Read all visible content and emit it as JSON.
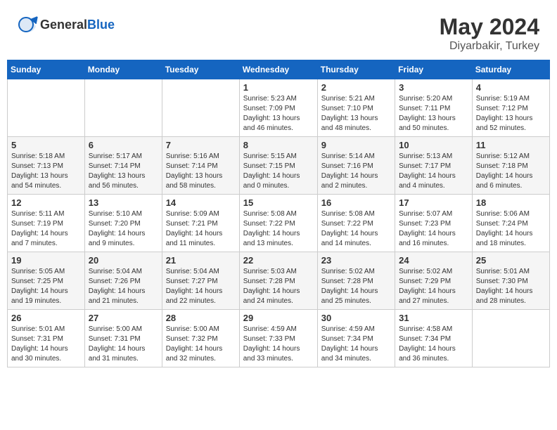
{
  "header": {
    "logo_general": "General",
    "logo_blue": "Blue",
    "month_year": "May 2024",
    "location": "Diyarbakir, Turkey"
  },
  "days_of_week": [
    "Sunday",
    "Monday",
    "Tuesday",
    "Wednesday",
    "Thursday",
    "Friday",
    "Saturday"
  ],
  "weeks": [
    [
      {
        "day": "",
        "info": ""
      },
      {
        "day": "",
        "info": ""
      },
      {
        "day": "",
        "info": ""
      },
      {
        "day": "1",
        "info": "Sunrise: 5:23 AM\nSunset: 7:09 PM\nDaylight: 13 hours\nand 46 minutes."
      },
      {
        "day": "2",
        "info": "Sunrise: 5:21 AM\nSunset: 7:10 PM\nDaylight: 13 hours\nand 48 minutes."
      },
      {
        "day": "3",
        "info": "Sunrise: 5:20 AM\nSunset: 7:11 PM\nDaylight: 13 hours\nand 50 minutes."
      },
      {
        "day": "4",
        "info": "Sunrise: 5:19 AM\nSunset: 7:12 PM\nDaylight: 13 hours\nand 52 minutes."
      }
    ],
    [
      {
        "day": "5",
        "info": "Sunrise: 5:18 AM\nSunset: 7:13 PM\nDaylight: 13 hours\nand 54 minutes."
      },
      {
        "day": "6",
        "info": "Sunrise: 5:17 AM\nSunset: 7:14 PM\nDaylight: 13 hours\nand 56 minutes."
      },
      {
        "day": "7",
        "info": "Sunrise: 5:16 AM\nSunset: 7:14 PM\nDaylight: 13 hours\nand 58 minutes."
      },
      {
        "day": "8",
        "info": "Sunrise: 5:15 AM\nSunset: 7:15 PM\nDaylight: 14 hours\nand 0 minutes."
      },
      {
        "day": "9",
        "info": "Sunrise: 5:14 AM\nSunset: 7:16 PM\nDaylight: 14 hours\nand 2 minutes."
      },
      {
        "day": "10",
        "info": "Sunrise: 5:13 AM\nSunset: 7:17 PM\nDaylight: 14 hours\nand 4 minutes."
      },
      {
        "day": "11",
        "info": "Sunrise: 5:12 AM\nSunset: 7:18 PM\nDaylight: 14 hours\nand 6 minutes."
      }
    ],
    [
      {
        "day": "12",
        "info": "Sunrise: 5:11 AM\nSunset: 7:19 PM\nDaylight: 14 hours\nand 7 minutes."
      },
      {
        "day": "13",
        "info": "Sunrise: 5:10 AM\nSunset: 7:20 PM\nDaylight: 14 hours\nand 9 minutes."
      },
      {
        "day": "14",
        "info": "Sunrise: 5:09 AM\nSunset: 7:21 PM\nDaylight: 14 hours\nand 11 minutes."
      },
      {
        "day": "15",
        "info": "Sunrise: 5:08 AM\nSunset: 7:22 PM\nDaylight: 14 hours\nand 13 minutes."
      },
      {
        "day": "16",
        "info": "Sunrise: 5:08 AM\nSunset: 7:22 PM\nDaylight: 14 hours\nand 14 minutes."
      },
      {
        "day": "17",
        "info": "Sunrise: 5:07 AM\nSunset: 7:23 PM\nDaylight: 14 hours\nand 16 minutes."
      },
      {
        "day": "18",
        "info": "Sunrise: 5:06 AM\nSunset: 7:24 PM\nDaylight: 14 hours\nand 18 minutes."
      }
    ],
    [
      {
        "day": "19",
        "info": "Sunrise: 5:05 AM\nSunset: 7:25 PM\nDaylight: 14 hours\nand 19 minutes."
      },
      {
        "day": "20",
        "info": "Sunrise: 5:04 AM\nSunset: 7:26 PM\nDaylight: 14 hours\nand 21 minutes."
      },
      {
        "day": "21",
        "info": "Sunrise: 5:04 AM\nSunset: 7:27 PM\nDaylight: 14 hours\nand 22 minutes."
      },
      {
        "day": "22",
        "info": "Sunrise: 5:03 AM\nSunset: 7:28 PM\nDaylight: 14 hours\nand 24 minutes."
      },
      {
        "day": "23",
        "info": "Sunrise: 5:02 AM\nSunset: 7:28 PM\nDaylight: 14 hours\nand 25 minutes."
      },
      {
        "day": "24",
        "info": "Sunrise: 5:02 AM\nSunset: 7:29 PM\nDaylight: 14 hours\nand 27 minutes."
      },
      {
        "day": "25",
        "info": "Sunrise: 5:01 AM\nSunset: 7:30 PM\nDaylight: 14 hours\nand 28 minutes."
      }
    ],
    [
      {
        "day": "26",
        "info": "Sunrise: 5:01 AM\nSunset: 7:31 PM\nDaylight: 14 hours\nand 30 minutes."
      },
      {
        "day": "27",
        "info": "Sunrise: 5:00 AM\nSunset: 7:31 PM\nDaylight: 14 hours\nand 31 minutes."
      },
      {
        "day": "28",
        "info": "Sunrise: 5:00 AM\nSunset: 7:32 PM\nDaylight: 14 hours\nand 32 minutes."
      },
      {
        "day": "29",
        "info": "Sunrise: 4:59 AM\nSunset: 7:33 PM\nDaylight: 14 hours\nand 33 minutes."
      },
      {
        "day": "30",
        "info": "Sunrise: 4:59 AM\nSunset: 7:34 PM\nDaylight: 14 hours\nand 34 minutes."
      },
      {
        "day": "31",
        "info": "Sunrise: 4:58 AM\nSunset: 7:34 PM\nDaylight: 14 hours\nand 36 minutes."
      },
      {
        "day": "",
        "info": ""
      }
    ]
  ]
}
